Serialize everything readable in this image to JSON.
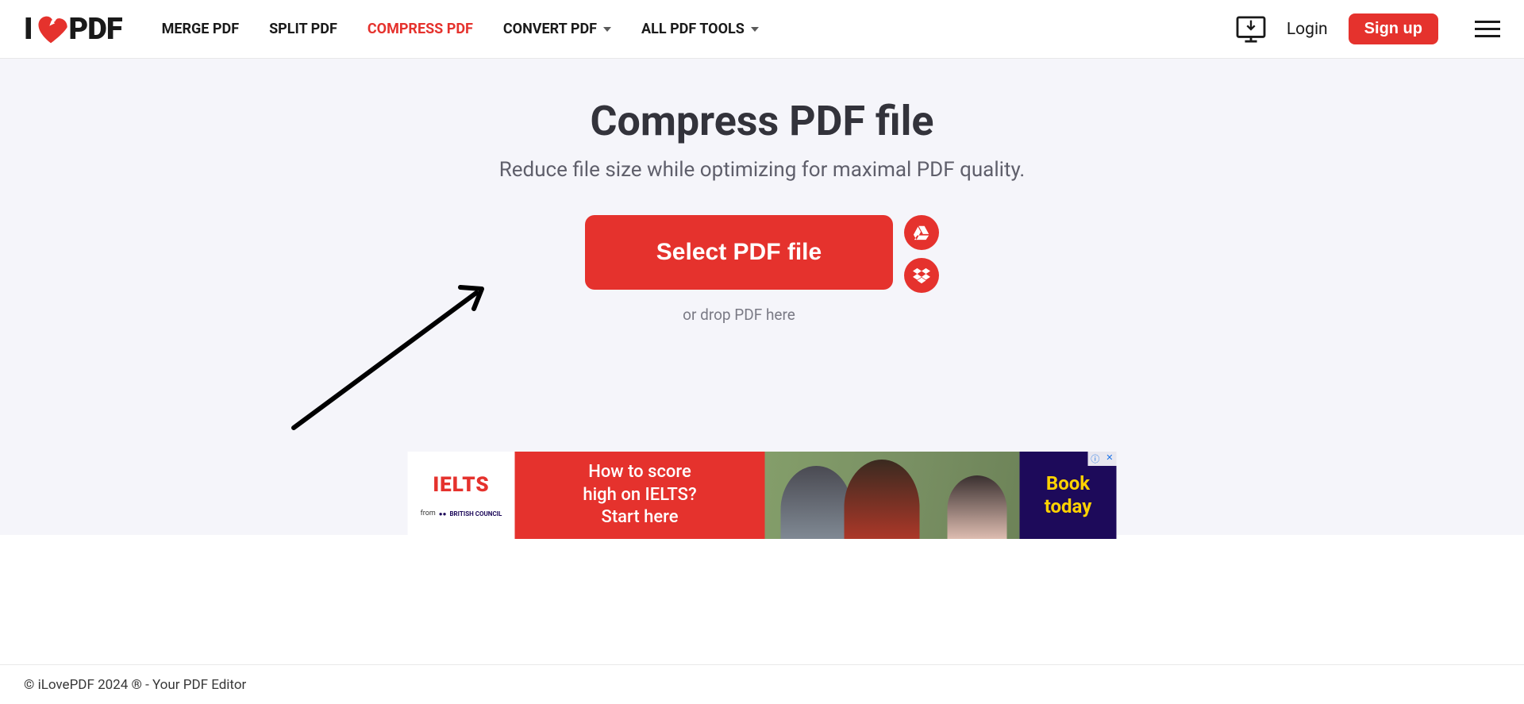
{
  "logo": {
    "prefix": "I",
    "suffix": "PDF"
  },
  "nav": {
    "merge": "MERGE PDF",
    "split": "SPLIT PDF",
    "compress": "COMPRESS PDF",
    "convert": "CONVERT PDF",
    "all_tools": "ALL PDF TOOLS"
  },
  "header": {
    "login": "Login",
    "signup": "Sign up"
  },
  "main": {
    "title": "Compress PDF file",
    "subtitle": "Reduce file size while optimizing for maximal PDF quality.",
    "select_button": "Select PDF file",
    "drop_text": "or drop PDF here"
  },
  "ad": {
    "ielts": "IELTS",
    "from": "from",
    "council": "BRITISH COUNCIL",
    "headline_1": "How to score",
    "headline_2": "high on IELTS?",
    "headline_3": "Start here",
    "cta_1": "Book",
    "cta_2": "today",
    "info_icon": "ⓘ",
    "close_icon": "✕"
  },
  "footer": {
    "copyright": "© iLovePDF 2024 ® - Your PDF Editor"
  }
}
